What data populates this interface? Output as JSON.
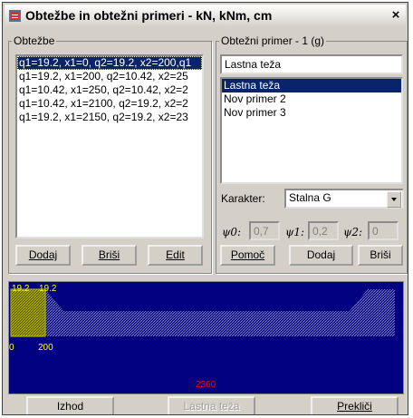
{
  "window": {
    "title": "Obtežbe in obtežni primeri - kN, kNm, cm",
    "close_glyph": "×",
    "app_icon": "app-icon"
  },
  "loads": {
    "group_label": "Obtežbe",
    "items": [
      "q1=19.2, x1=0, q2=19.2, x2=200,q1",
      "q1=19.2, x1=200, q2=10.42, x2=25",
      "q1=10.42, x1=250, q2=10.42, x2=2",
      "q1=10.42, x1=2100, q2=19.2, x2=2",
      "q1=19.2, x1=2150, q2=19.2, x2=23"
    ],
    "selected_index": 0,
    "add_label": "Dodaj",
    "delete_label": "Briši",
    "edit_label": "Edit"
  },
  "cases": {
    "group_label": "Obtežni primer - 1 (g)",
    "name_value": "Lastna teža",
    "items": [
      "Lastna teža",
      "Nov primer 2",
      "Nov primer 3"
    ],
    "selected_index": 0,
    "character_label": "Karakter:",
    "character_value": "Stalna G",
    "psi0_label": "ψ0:",
    "psi0_value": "0,7",
    "psi1_label": "ψ1:",
    "psi1_value": "0,2",
    "psi2_label": "ψ2:",
    "psi2_value": "0",
    "help_label": "Pomoč",
    "add_label": "Dodaj",
    "delete_label": "Briši"
  },
  "diagram": {
    "label_q_left": "19.2",
    "label_q_right": "19.2",
    "label_x0": "0",
    "label_x200": "200",
    "label_total": "2360",
    "colors": {
      "background": "#000080",
      "load_fill": "#8080c0",
      "selected_fill": "#c0c000",
      "text": "#ffff00",
      "total_text": "#ff0000"
    }
  },
  "footer": {
    "exit_label": "Izhod",
    "case_label": "Lastna teža",
    "cancel_label": "Prekliči"
  }
}
